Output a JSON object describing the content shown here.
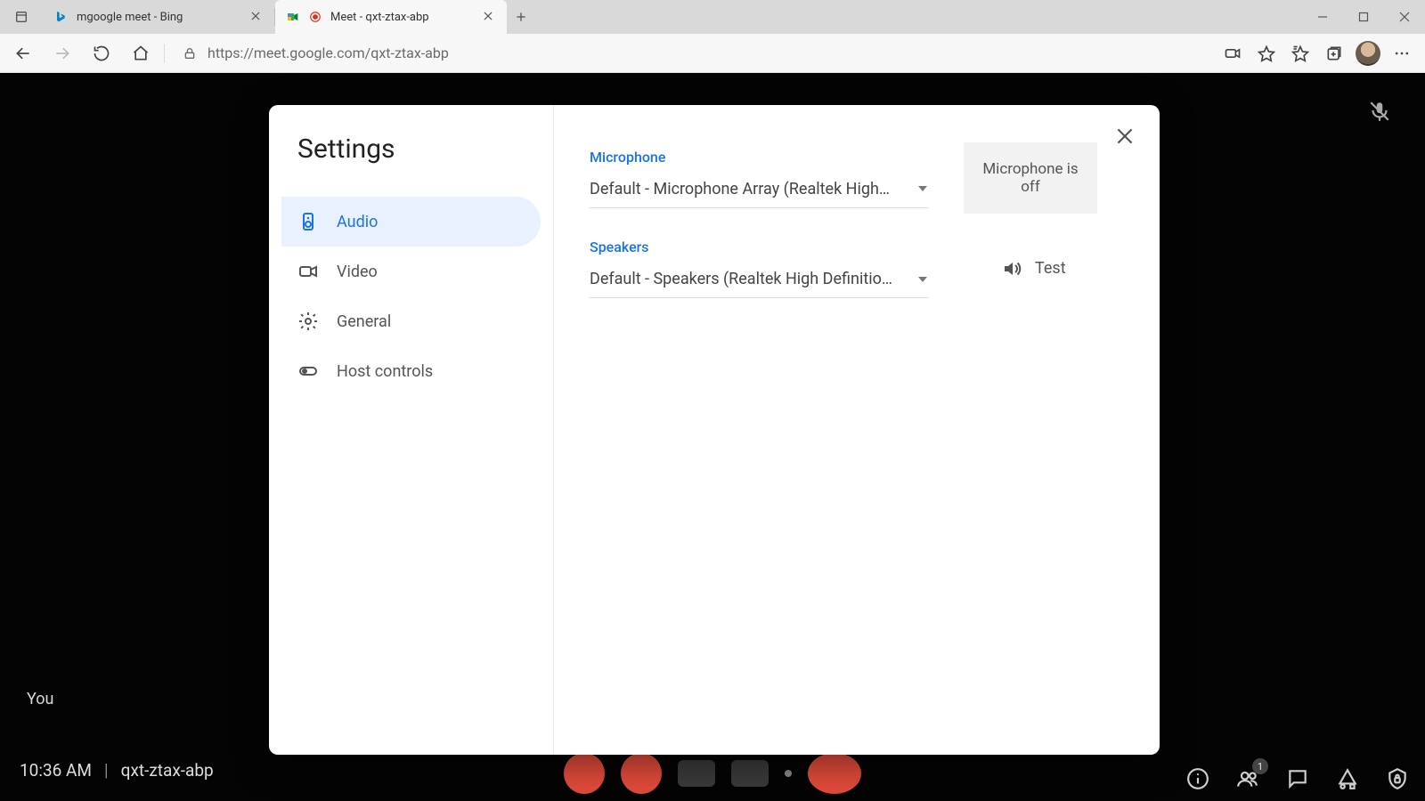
{
  "browser": {
    "tabs": [
      {
        "title": "mgoogle meet - Bing",
        "active": false
      },
      {
        "title": "Meet - qxt-ztax-abp",
        "active": true
      }
    ],
    "url_display": "https://meet.google.com/qxt-ztax-abp"
  },
  "meet": {
    "you_label": "You",
    "clock": "10:36 AM",
    "meeting_code": "qxt-ztax-abp",
    "participants_badge": "1"
  },
  "settings": {
    "title": "Settings",
    "nav": {
      "audio": "Audio",
      "video": "Video",
      "general": "General",
      "host": "Host controls"
    },
    "audio": {
      "mic_label": "Microphone",
      "mic_value": "Default - Microphone Array (Realtek High …",
      "mic_status": "Microphone is off",
      "spk_label": "Speakers",
      "spk_value": "Default - Speakers (Realtek High Definitio…",
      "test_label": "Test"
    }
  }
}
